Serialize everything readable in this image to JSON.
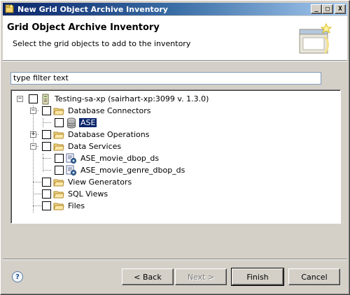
{
  "window": {
    "title": "New Grid Object Archive Inventory",
    "controls": {
      "minimize": "_",
      "maximize": "□",
      "close": "X"
    }
  },
  "header": {
    "title": "Grid Object Archive Inventory",
    "description": "Select the grid objects to add to the inventory"
  },
  "filter": {
    "value": "type filter text"
  },
  "tree": {
    "items": [
      {
        "label": "Testing-sa-xp (sairhart-xp:3099 v. 1.3.0)",
        "icon": "server-icon",
        "expander": "−",
        "checked": false
      },
      {
        "label": "Database Connectors",
        "icon": "folder-icon",
        "expander": "−",
        "checked": false
      },
      {
        "label": "ASE",
        "icon": "database-icon",
        "checked": false,
        "selected": true
      },
      {
        "label": "Database Operations",
        "icon": "folder-icon",
        "expander": "+",
        "checked": false
      },
      {
        "label": "Data Services",
        "icon": "folder-icon",
        "expander": "−",
        "checked": false
      },
      {
        "label": "ASE_movie_dbop_ds",
        "icon": "data-service-icon",
        "checked": false
      },
      {
        "label": "ASE_movie_genre_dbop_ds",
        "icon": "data-service-icon",
        "checked": false
      },
      {
        "label": "View Generators",
        "icon": "folder-icon",
        "checked": false
      },
      {
        "label": "SQL Views",
        "icon": "folder-icon",
        "checked": false
      },
      {
        "label": "Files",
        "icon": "folder-icon",
        "checked": false
      }
    ]
  },
  "buttons": {
    "help": "?",
    "back": "< Back",
    "next": "Next >",
    "finish": "Finish",
    "cancel": "Cancel"
  },
  "colors": {
    "titlebar_start": "#0a246a",
    "titlebar_end": "#a6caf0",
    "selection": "#0a246a",
    "dialog_bg": "#d4d0c8"
  }
}
